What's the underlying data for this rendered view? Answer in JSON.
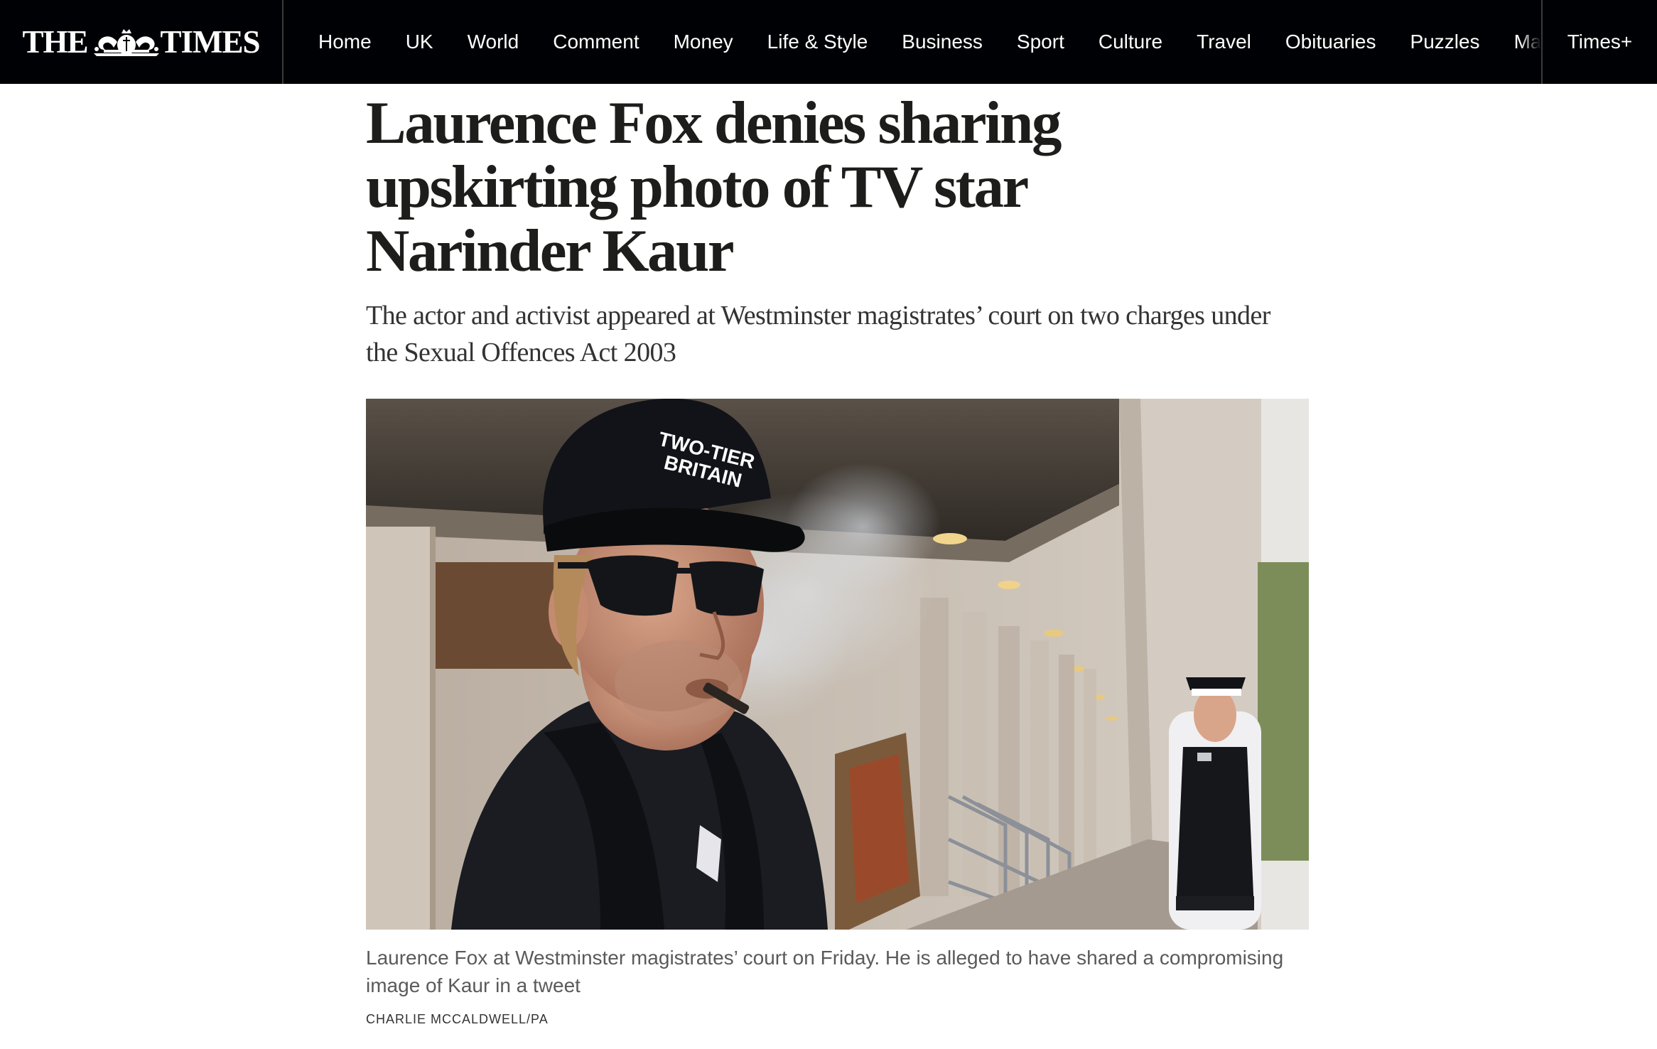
{
  "masthead": {
    "left_word": "THE",
    "right_word": "TIMES"
  },
  "nav": {
    "items": [
      "Home",
      "UK",
      "World",
      "Comment",
      "Money",
      "Life & Style",
      "Business",
      "Sport",
      "Culture",
      "Travel",
      "Obituaries",
      "Puzzles",
      "Mag"
    ],
    "subscribe": "Times+"
  },
  "article": {
    "headline": "Laurence Fox denies sharing upskirting photo of TV star Narinder Kaur",
    "standfirst": "The actor and activist appeared at Westminster magistrates’ court on two charges under the Sexual Offences Act 2003",
    "image": {
      "cap_text_line1": "TWO-TIER",
      "cap_text_line2": "BRITAIN"
    },
    "caption": "Laurence Fox at Westminster magistrates’ court on Friday. He is alleged to have shared a compromising image of Kaur in a tweet",
    "credit": "CHARLIE MCCALDWELL/PA"
  }
}
